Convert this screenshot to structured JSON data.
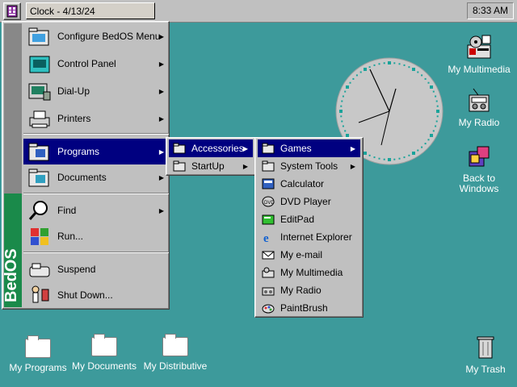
{
  "taskbar": {
    "window_title": "Clock - 4/13/24",
    "time": "8:33 AM"
  },
  "start_menu": {
    "brand": "BedOS",
    "items": [
      {
        "label": "Configure BedOS Menu",
        "icon": "folder-gear-icon",
        "has_submenu": true
      },
      {
        "label": "Control Panel",
        "icon": "control-panel-icon",
        "has_submenu": true
      },
      {
        "label": "Dial-Up",
        "icon": "dialup-icon",
        "has_submenu": true
      },
      {
        "label": "Printers",
        "icon": "printer-icon",
        "has_submenu": true
      },
      {
        "label": "Programs",
        "icon": "programs-folder-icon",
        "has_submenu": true,
        "selected": true
      },
      {
        "label": "Documents",
        "icon": "documents-folder-icon",
        "has_submenu": true
      },
      {
        "label": "Find",
        "icon": "magnifier-icon",
        "has_submenu": true
      },
      {
        "label": "Run...",
        "icon": "run-icon",
        "has_submenu": false
      },
      {
        "label": "Suspend",
        "icon": "suspend-icon",
        "has_submenu": false
      },
      {
        "label": "Shut Down...",
        "icon": "shutdown-icon",
        "has_submenu": false
      }
    ]
  },
  "programs_menu": {
    "items": [
      {
        "label": "Accessories",
        "has_submenu": true,
        "selected": true
      },
      {
        "label": "StartUp",
        "has_submenu": true
      }
    ]
  },
  "accessories_menu": {
    "items": [
      {
        "label": "Games",
        "has_submenu": true,
        "selected": true
      },
      {
        "label": "System Tools",
        "has_submenu": true
      },
      {
        "label": "Calculator"
      },
      {
        "label": "DVD Player"
      },
      {
        "label": "EditPad"
      },
      {
        "label": "Internet Explorer"
      },
      {
        "label": "My e-mail"
      },
      {
        "label": "My Multimedia"
      },
      {
        "label": "My Radio"
      },
      {
        "label": "PaintBrush"
      }
    ]
  },
  "desktop": {
    "icons": [
      {
        "label": "My Multimedia",
        "icon": "multimedia-icon"
      },
      {
        "label": "My Radio",
        "icon": "radio-icon"
      },
      {
        "label": "Back to Windows",
        "icon": "blocks-icon"
      },
      {
        "label": "My Programs",
        "icon": "folder-icon"
      },
      {
        "label": "My Documents",
        "icon": "folder-icon"
      },
      {
        "label": "My Distributive",
        "icon": "folder-icon"
      },
      {
        "label": "My Trash",
        "icon": "trash-icon"
      }
    ]
  },
  "colors": {
    "desktop": "#3d9a9b",
    "menu": "#c0c0c0",
    "selection": "#000080",
    "clock_face": "#c8c8c8",
    "clock_ticks": "#1aa39a"
  }
}
